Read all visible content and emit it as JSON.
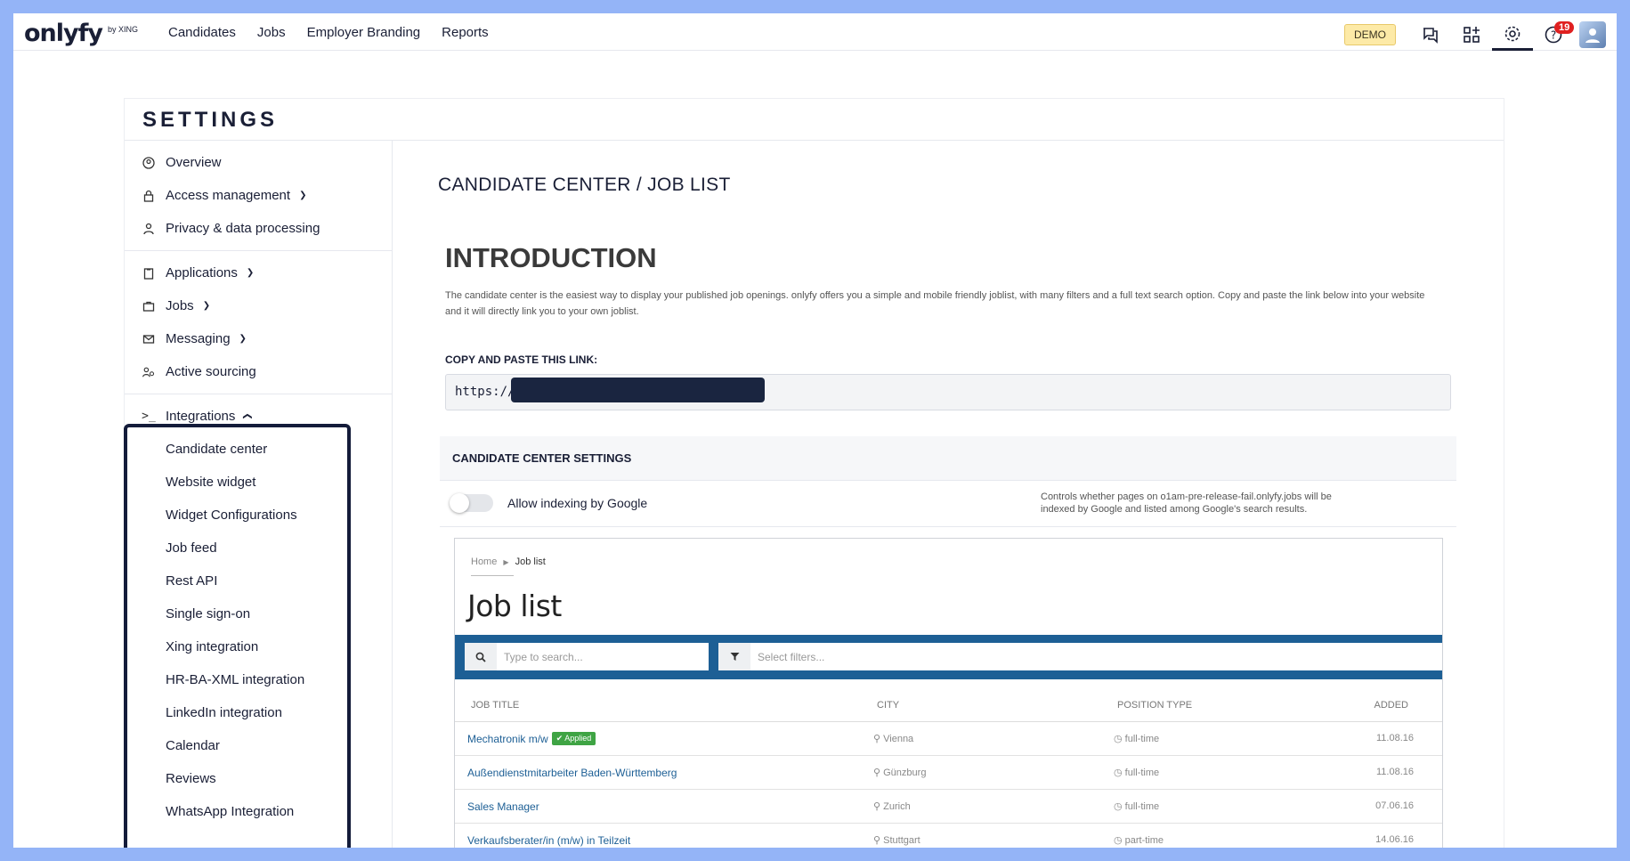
{
  "topnav": {
    "logo": "onlyfy",
    "logo_sub": "by XING",
    "links": [
      "Candidates",
      "Jobs",
      "Employer Branding",
      "Reports"
    ],
    "demo": "DEMO",
    "notifications": "19",
    "icons": [
      "chat-icon",
      "apps-grid-icon",
      "gear-icon",
      "help-icon"
    ]
  },
  "settings": {
    "title": "SETTINGS",
    "groups": [
      [
        {
          "label": "Overview",
          "icon": "user-circle-icon"
        },
        {
          "label": "Access management",
          "icon": "lock-icon",
          "chevron": "down"
        },
        {
          "label": "Privacy & data processing",
          "icon": "privacy-icon"
        }
      ],
      [
        {
          "label": "Applications",
          "icon": "clipboard-icon",
          "chevron": "down"
        },
        {
          "label": "Jobs",
          "icon": "briefcase-icon",
          "chevron": "down"
        },
        {
          "label": "Messaging",
          "icon": "envelope-icon",
          "chevron": "down"
        },
        {
          "label": "Active sourcing",
          "icon": "user-search-icon"
        }
      ]
    ],
    "integrations": {
      "label": "Integrations",
      "icon": "terminal-icon",
      "chevron": "up",
      "items": [
        "Candidate center",
        "Website widget",
        "Widget Configurations",
        "Job feed",
        "Rest API",
        "Single sign-on",
        "Xing integration",
        "HR-BA-XML integration",
        "LinkedIn integration",
        "Calendar",
        "Reviews",
        "WhatsApp Integration"
      ],
      "active": "Candidate center"
    }
  },
  "content": {
    "breadcrumb": "CANDIDATE CENTER / JOB LIST",
    "intro_title": "INTRODUCTION",
    "intro_text": "The candidate center is the easiest way to display your published job openings. onlyfy offers you a simple and mobile friendly joblist, with many filters and a full text search option. Copy and paste the link below into your website and it will directly link you to your own joblist.",
    "copy_label": "COPY AND PASTE THIS LINK:",
    "link_prefix": "https://",
    "cc_settings_title": "CANDIDATE CENTER SETTINGS",
    "toggle_label": "Allow indexing by Google",
    "toggle_on": false,
    "toggle_desc": "Controls whether pages on o1am-pre-release-fail.onlyfy.jobs will be indexed by Google and listed among Google's search results."
  },
  "preview": {
    "crumb_home": "Home",
    "crumb_current": "Job list",
    "title": "Job list",
    "search_placeholder": "Type to search...",
    "filter_placeholder": "Select filters...",
    "columns": [
      "JOB TITLE",
      "CITY",
      "POSITION TYPE",
      "ADDED"
    ],
    "applied_label": "Applied",
    "rows": [
      {
        "title": "Mechatronik m/w",
        "applied": true,
        "city": "Vienna",
        "type": "full-time",
        "added": "11.08.16"
      },
      {
        "title": "Außendienstmitarbeiter Baden-Württemberg",
        "applied": false,
        "city": "Günzburg",
        "type": "full-time",
        "added": "11.08.16"
      },
      {
        "title": "Sales Manager",
        "applied": false,
        "city": "Zurich",
        "type": "full-time",
        "added": "07.06.16"
      },
      {
        "title": "Verkaufsberater/in (m/w) in Teilzeit",
        "applied": false,
        "city": "Stuttgart",
        "type": "part-time",
        "added": "14.06.16"
      }
    ]
  }
}
